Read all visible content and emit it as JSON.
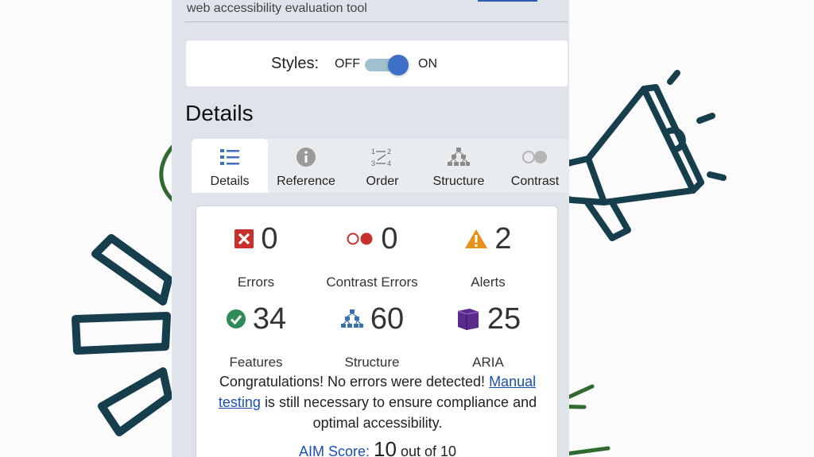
{
  "header": {
    "subtitle": "web accessibility evaluation tool"
  },
  "styles_toggle": {
    "label": "Styles:",
    "off_label": "OFF",
    "on_label": "ON",
    "state": "on"
  },
  "section": {
    "heading": "Details"
  },
  "tabs": [
    {
      "label": "Details",
      "icon": "list-icon",
      "active": true
    },
    {
      "label": "Reference",
      "icon": "info-icon",
      "active": false
    },
    {
      "label": "Order",
      "icon": "order-icon",
      "active": false
    },
    {
      "label": "Structure",
      "icon": "hierarchy-icon",
      "active": false
    },
    {
      "label": "Contrast",
      "icon": "contrast-icon",
      "active": false
    }
  ],
  "summary": {
    "errors": {
      "count": "0",
      "label": "Errors",
      "icon": "error-x-icon",
      "color": "#c9302c"
    },
    "contrast_errors": {
      "count": "0",
      "label": "Contrast Errors",
      "icon": "contrast-error-icon",
      "color": "#c9302c"
    },
    "alerts": {
      "count": "2",
      "label": "Alerts",
      "icon": "alert-triangle-icon",
      "color": "#e8901a"
    },
    "features": {
      "count": "34",
      "label": "Features",
      "icon": "check-circle-icon",
      "color": "#2e8b57"
    },
    "structure": {
      "count": "60",
      "label": "Structure",
      "icon": "hierarchy-icon",
      "color": "#3a6fb0"
    },
    "aria": {
      "count": "25",
      "label": "ARIA",
      "icon": "aria-cube-icon",
      "color": "#5a2a8c"
    }
  },
  "message": {
    "text_before": "Congratulations! No errors were detected!",
    "link_manual": "Manual",
    "link_testing": "testing",
    "text_after": "is still necessary to ensure compliance and optimal accessibility."
  },
  "aim_score": {
    "label": "AIM Score:",
    "value": "10",
    "suffix": "out of 10"
  },
  "colors": {
    "accent_blue": "#3f70c7",
    "annotation_green": "#2f6b2f",
    "megaphone": "#173e4c",
    "panel_bg": "#dfe4ea"
  }
}
